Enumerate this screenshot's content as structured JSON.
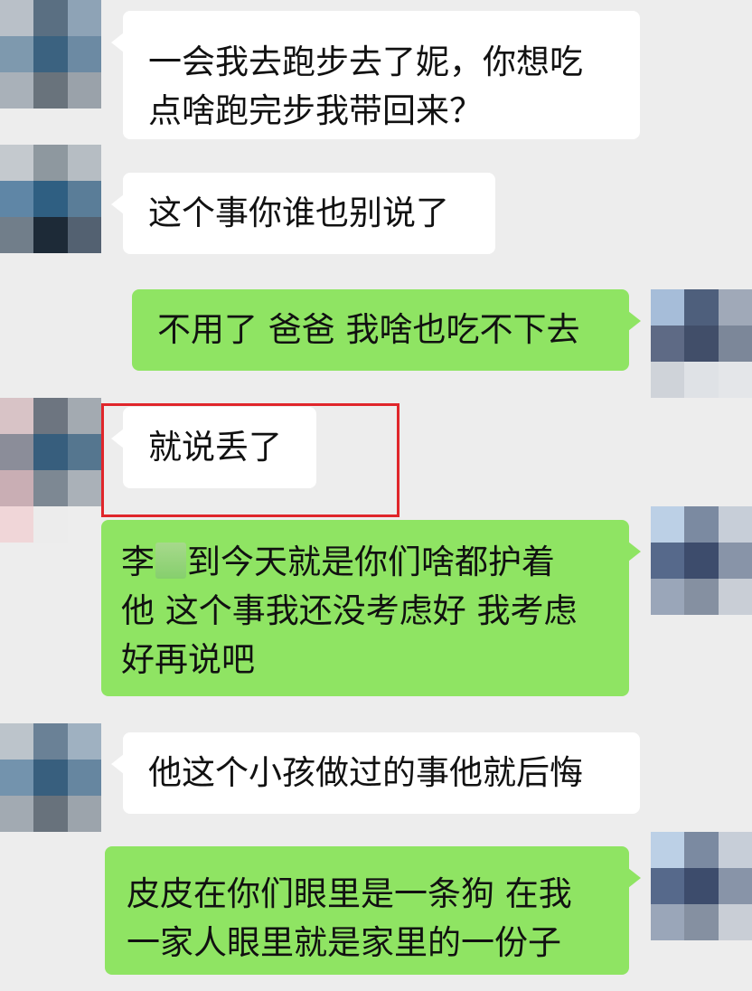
{
  "chat": {
    "messages": [
      {
        "side": "left",
        "text": "一会我去跑步去了妮，你想吃\n点啥跑完步我带回来？"
      },
      {
        "side": "left",
        "text": "这个事你谁也别说了"
      },
      {
        "side": "right",
        "text": "不用了 爸爸 我啥也吃不下去"
      },
      {
        "side": "left",
        "text": "就说丢了"
      },
      {
        "side": "right",
        "text_before": "李",
        "text_after": "到今天就是你们啥都护着\n他 这个事我还没考虑好 我考虑\n好再说吧"
      },
      {
        "side": "left",
        "text": "他这个小孩做过的事他就后悔"
      },
      {
        "side": "right",
        "text": "皮皮在你们眼里是一条狗 在我\n一家人眼里就是家里的一份子"
      }
    ]
  },
  "colors": {
    "background": "#ededed",
    "received_bubble": "#ffffff",
    "sent_bubble": "#8fe463",
    "highlight_border": "#e0262b"
  },
  "icons": {
    "avatar": "pixelated-avatar-icon",
    "redaction": "censor-blur"
  }
}
